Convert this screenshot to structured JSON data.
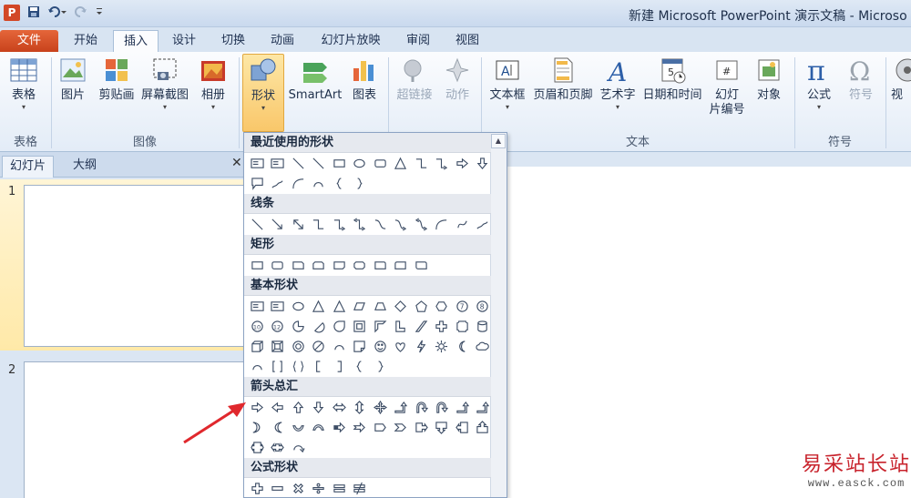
{
  "window": {
    "app_icon": "P",
    "title": "新建 Microsoft PowerPoint 演示文稿 - Microso",
    "qat": [
      "save-icon",
      "undo-icon",
      "redo-icon",
      "customize-icon"
    ]
  },
  "tabs": [
    "文件",
    "开始",
    "插入",
    "设计",
    "切换",
    "动画",
    "幻灯片放映",
    "审阅",
    "视图"
  ],
  "ribbon": {
    "buttons": [
      {
        "label": "表格",
        "icon": "table-icon",
        "arrow": true
      },
      {
        "label": "图片",
        "icon": "picture-icon",
        "arrow": false
      },
      {
        "label": "剪贴画",
        "icon": "clipart-icon",
        "arrow": false
      },
      {
        "label": "屏幕截图",
        "icon": "screenshot-icon",
        "arrow": true
      },
      {
        "label": "相册",
        "icon": "album-icon",
        "arrow": true
      },
      {
        "label": "形状",
        "icon": "shapes-icon",
        "arrow": true
      },
      {
        "label": "SmartArt",
        "icon": "smartart-icon",
        "arrow": false
      },
      {
        "label": "图表",
        "icon": "chart-icon",
        "arrow": false
      },
      {
        "label": "超链接",
        "icon": "hyperlink-icon",
        "arrow": false
      },
      {
        "label": "动作",
        "icon": "action-icon",
        "arrow": false
      },
      {
        "label": "文本框",
        "icon": "textbox-icon",
        "arrow": true
      },
      {
        "label": "页眉和页脚",
        "icon": "header-footer-icon",
        "arrow": false
      },
      {
        "label": "艺术字",
        "icon": "wordart-icon",
        "arrow": true
      },
      {
        "label": "日期和时间",
        "icon": "datetime-icon",
        "arrow": false
      },
      {
        "label": "幻灯",
        "label2": "片编号",
        "icon": "slide-number-icon",
        "arrow": false
      },
      {
        "label": "对象",
        "icon": "object-icon",
        "arrow": false
      },
      {
        "label": "公式",
        "icon": "equation-icon",
        "arrow": true
      },
      {
        "label": "符号",
        "icon": "symbol-icon",
        "arrow": false
      },
      {
        "label": "视",
        "icon": "video-icon",
        "arrow": false
      }
    ],
    "groups": [
      "表格",
      "图像",
      "文本",
      "符号"
    ]
  },
  "panel": {
    "tabs": [
      "幻灯片",
      "大纲"
    ],
    "close": "✕",
    "slides": [
      "1",
      "2"
    ]
  },
  "shapes_menu": {
    "sections": [
      "最近使用的形状",
      "线条",
      "矩形",
      "基本形状",
      "箭头总汇",
      "公式形状"
    ]
  },
  "watermark": {
    "line1": "易采站长站",
    "line2": "www.easck.com"
  },
  "colors": {
    "accent": "#d24726",
    "selected": "#f9c76a",
    "arrow": "#e0282d"
  }
}
